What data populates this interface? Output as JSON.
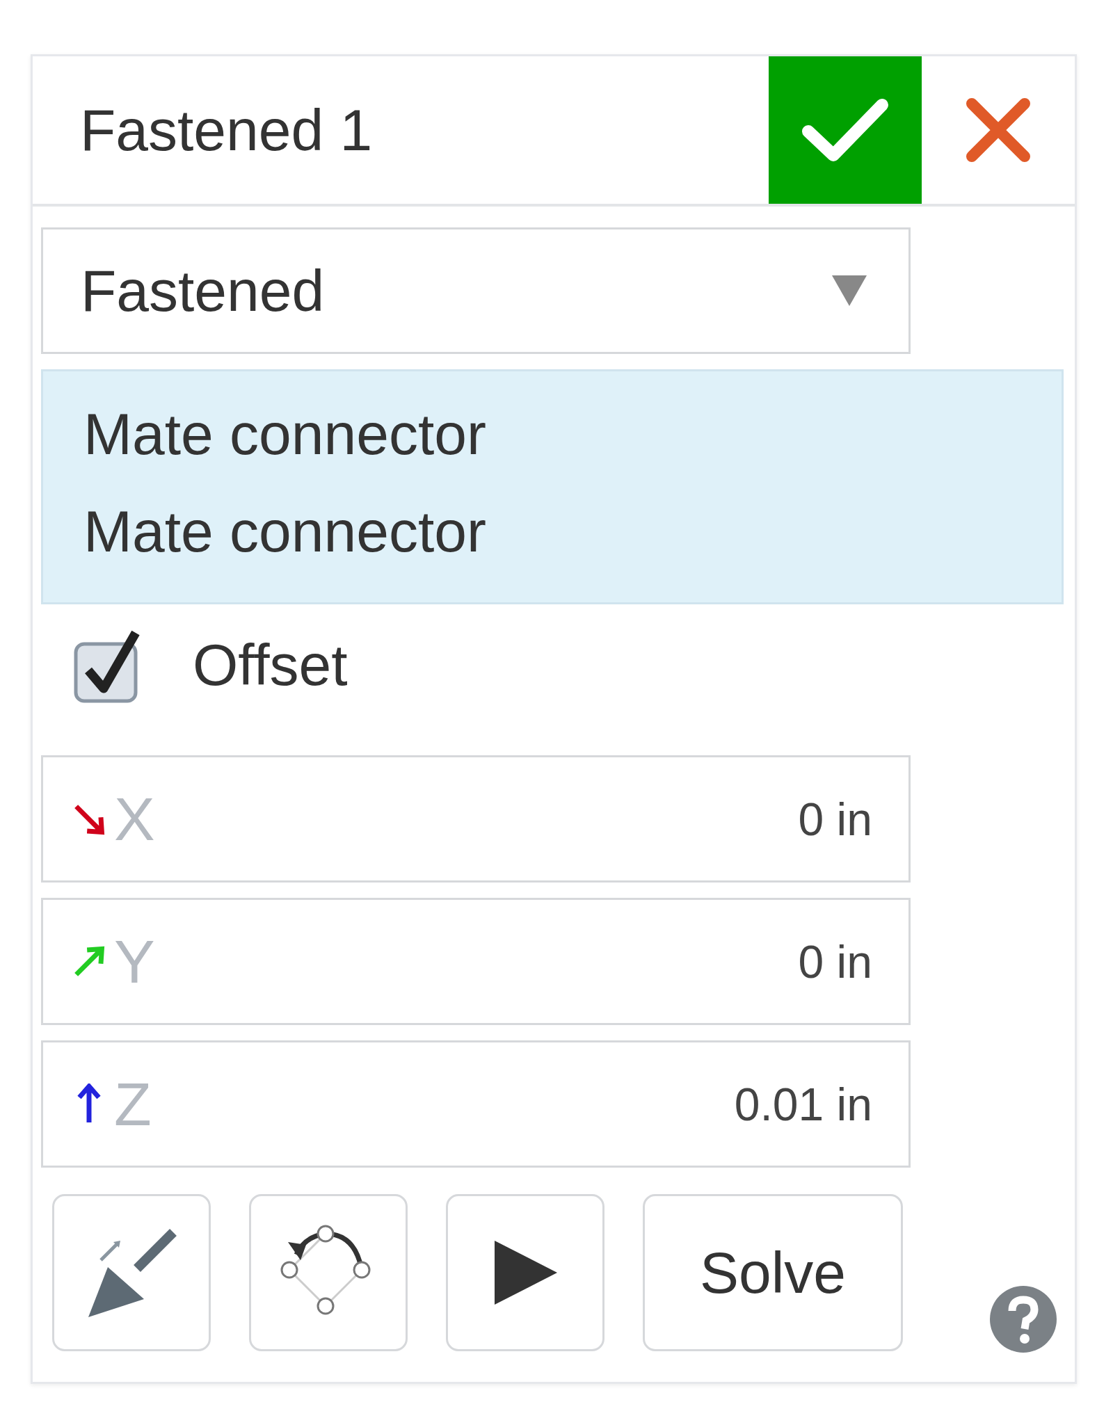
{
  "header": {
    "title": "Fastened 1"
  },
  "mate_type": {
    "value": "Fastened"
  },
  "selections": [
    {
      "label": "Mate connector"
    },
    {
      "label": "Mate connector"
    }
  ],
  "offset": {
    "label": "Offset",
    "checked": true
  },
  "offset_fields": [
    {
      "axis": "X",
      "value": "0 in",
      "color": "#d0021b",
      "kind": "southeast"
    },
    {
      "axis": "Y",
      "value": "0 in",
      "color": "#22cc22",
      "kind": "northeast"
    },
    {
      "axis": "Z",
      "value": "0.01 in",
      "color": "#2222dd",
      "kind": "north"
    }
  ],
  "solve_button": {
    "label": "Solve"
  }
}
